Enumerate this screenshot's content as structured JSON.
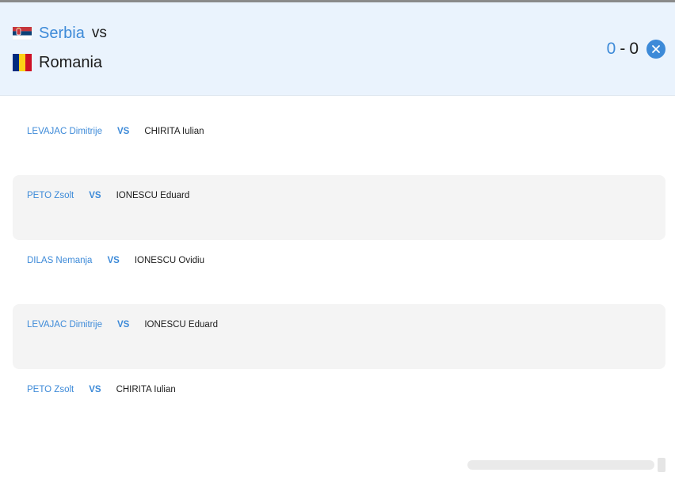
{
  "header": {
    "home_team": {
      "name": "Serbia",
      "flag_icon": "serbia-flag-icon"
    },
    "vs_label": "vs",
    "away_team": {
      "name": "Romania",
      "flag_icon": "romania-flag-icon"
    },
    "score": {
      "home": "0",
      "separator": "-",
      "away": "0"
    },
    "close_icon": "close-icon"
  },
  "matches": [
    {
      "home_player": "LEVAJAC Dimitrije",
      "vs": "VS",
      "away_player": "CHIRITA Iulian"
    },
    {
      "home_player": "PETO Zsolt",
      "vs": "VS",
      "away_player": "IONESCU Eduard"
    },
    {
      "home_player": "DILAS Nemanja",
      "vs": "VS",
      "away_player": "IONESCU Ovidiu"
    },
    {
      "home_player": "LEVAJAC Dimitrije",
      "vs": "VS",
      "away_player": "IONESCU Eduard"
    },
    {
      "home_player": "PETO Zsolt",
      "vs": "VS",
      "away_player": "CHIRITA Iulian"
    }
  ],
  "colors": {
    "accent": "#3d8ad8",
    "header_bg": "#eaf3fd",
    "row_shade": "#f4f4f4",
    "text": "#1c1c1c"
  }
}
